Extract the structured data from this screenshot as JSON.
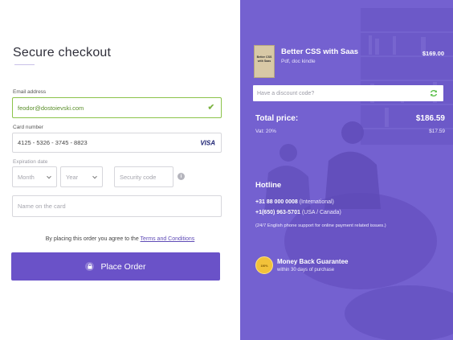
{
  "checkout": {
    "title": "Secure checkout",
    "email": {
      "label": "Email address",
      "value": "feodor@dostoievski.com"
    },
    "card": {
      "label": "Card number",
      "value": "4125 - 5326 - 3745 - 8823",
      "brand": "VISA"
    },
    "expiration": {
      "label": "Expiration date",
      "month_placeholder": "Month",
      "year_placeholder": "Year"
    },
    "security_code_placeholder": "Security code",
    "name_placeholder": "Name on the card",
    "terms_prefix": "By placing this order you agree to the",
    "terms_link": "Terms and Conditions",
    "place_order": "Place Order"
  },
  "summary": {
    "product": {
      "cover_text": "Better CSS with Saas",
      "name": "Better CSS with Saas",
      "format": "Pdf, doc kindle",
      "price": "$169.00"
    },
    "discount_placeholder": "Have a discount code?",
    "total_label": "Total price:",
    "total_value": "$186.59",
    "vat_label": "Vat: 20%",
    "vat_value": "$17.59",
    "hotline": {
      "title": "Hotline",
      "phone1": "+31 88 000 0008",
      "phone1_note": "(International)",
      "phone2": "+1(650) 963-5701",
      "phone2_note": "(USA / Canada)",
      "note": "(24/7 English phone support for online payment related issues.)"
    },
    "guarantee": {
      "badge": "100%",
      "title": "Money Back Guarantee",
      "subtitle": "within 30 days of purchase"
    }
  },
  "colors": {
    "accent": "#6a52c8",
    "panel": "#7360cf",
    "valid": "#8bc34a"
  }
}
